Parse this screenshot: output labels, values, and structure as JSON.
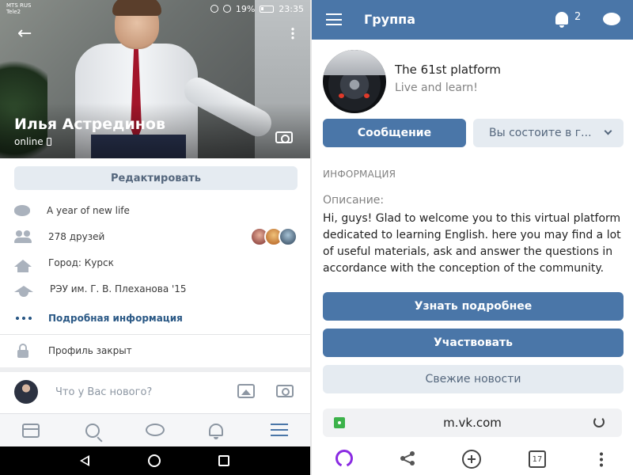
{
  "profile": {
    "status_bar": {
      "carrier_line1": "MTS RUS",
      "carrier_line2": "Tele2",
      "battery": "19%",
      "time": "23:35"
    },
    "name": "Илья Астрединов",
    "online": "online",
    "edit_button": "Редактировать",
    "info": [
      {
        "icon": "status-chat-icon",
        "text": "A year of new life"
      },
      {
        "icon": "friends-icon",
        "text": "278 друзей"
      },
      {
        "icon": "home-icon",
        "text": "Город: Курск"
      },
      {
        "icon": "graduation-cap-icon",
        "text": "РЭУ им. Г. В. Плеханова '15"
      },
      {
        "icon": "more-dots-icon",
        "text": "Подробная информация"
      }
    ],
    "closed_profile": "Профиль закрыт",
    "composer_placeholder": "Что у Вас нового?"
  },
  "group": {
    "header_title": "Группа",
    "notification_count": "2",
    "name": "The 61st platform",
    "tagline": "Live and learn!",
    "message_button": "Сообщение",
    "member_button": "Вы состоите в г...",
    "section_title": "ИНФОРМАЦИЯ",
    "description_label": "Описание:",
    "description": "Hi, guys! Glad to welcome you to this virtual platform dedicated to learning English. here you may find a lot of useful materials, ask and answer the questions in accordance with the conception of the community.",
    "learn_more_button": "Узнать подробнее",
    "participate_button": "Участвовать",
    "news_button": "Свежие новости",
    "url": "m.vk.com",
    "tabs_count": "17"
  },
  "colors": {
    "accent": "#4a76a8",
    "link": "#2a5885",
    "secondary_bg": "#e5ebf1",
    "secure": "#3cb24a"
  }
}
